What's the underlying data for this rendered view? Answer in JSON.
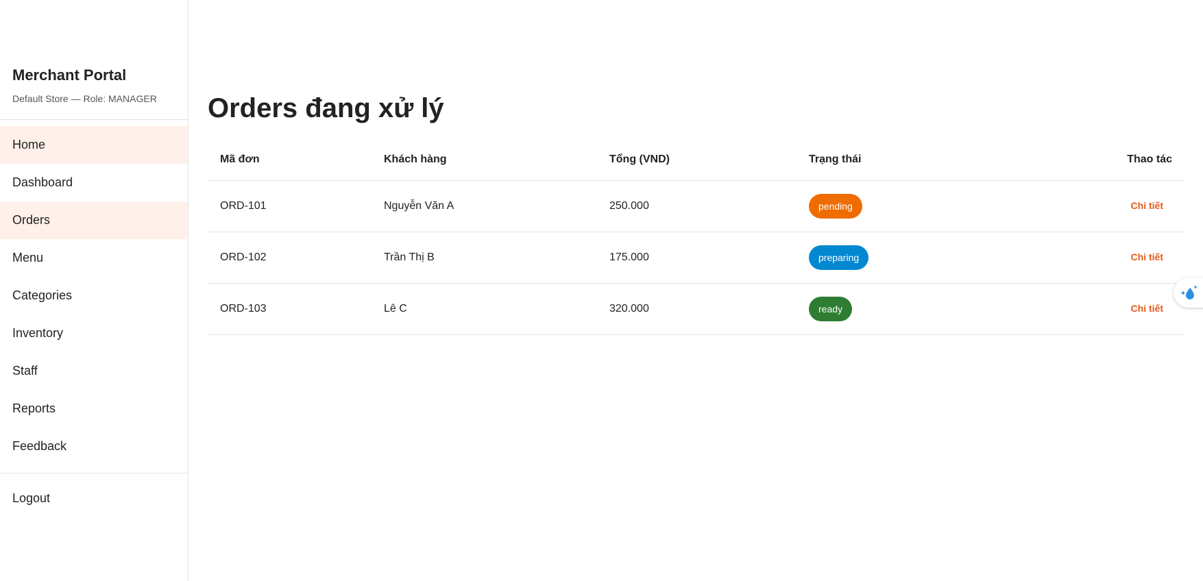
{
  "brand": {
    "title": "Merchant Portal",
    "subtitle": "Default Store — Role: MANAGER"
  },
  "sidebar": {
    "items": [
      {
        "label": "Home",
        "active": true
      },
      {
        "label": "Dashboard",
        "active": false
      },
      {
        "label": "Orders",
        "active": true
      },
      {
        "label": "Menu",
        "active": false
      },
      {
        "label": "Categories",
        "active": false
      },
      {
        "label": "Inventory",
        "active": false
      },
      {
        "label": "Staff",
        "active": false
      },
      {
        "label": "Reports",
        "active": false
      },
      {
        "label": "Feedback",
        "active": false
      }
    ],
    "logout_label": "Logout"
  },
  "main": {
    "title": "Orders đang xử lý",
    "table": {
      "headers": {
        "id": "Mã đơn",
        "customer": "Khách hàng",
        "total": "Tổng (VND)",
        "status": "Trạng thái",
        "actions": "Thao tác"
      },
      "rows": [
        {
          "id": "ORD-101",
          "customer": "Nguyễn Văn A",
          "total": "250.000",
          "status": "pending",
          "status_color": "#ef6c00",
          "action": "Chi tiết"
        },
        {
          "id": "ORD-102",
          "customer": "Trần Thị B",
          "total": "175.000",
          "status": "preparing",
          "status_color": "#0288d1",
          "action": "Chi tiết"
        },
        {
          "id": "ORD-103",
          "customer": "Lê C",
          "total": "320.000",
          "status": "ready",
          "status_color": "#2e7d32",
          "action": "Chi tiết"
        }
      ]
    }
  },
  "colors": {
    "accent": "#e55a1c",
    "active_nav_bg": "#fff0ea"
  },
  "floating_button": {
    "icon": "sparkle-droplet-icon"
  }
}
